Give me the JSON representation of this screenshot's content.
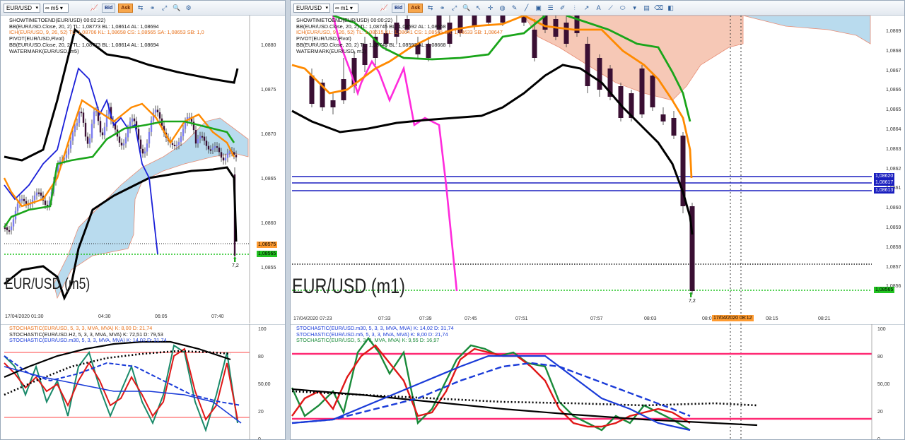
{
  "left_window": {
    "symbol": "EUR/USD",
    "timeframe": "m5",
    "bid_label": "Bid",
    "ask_label": "Ask",
    "legend": [
      {
        "text": "SHOWTIMETOEND(EUR/USD) 00:02:22)",
        "color": "#111111"
      },
      {
        "text": "BB(EUR/USD.Close, 20, 2)  TL: 1,08773  BL: 1,08614  AL: 1,08694",
        "color": "#111111"
      },
      {
        "text": "ICH(EUR/USD, 9, 26, 52)  TL: 1,08706  KL: 1,08658  CS: 1,08565  SA: 1,08653  SB: 1,0",
        "color": "#e8721c"
      },
      {
        "text": "PIVOT(EUR/USD,Pivot)",
        "color": "#111111"
      },
      {
        "text": "BB(EUR/USD.Close, 20, 2)  TL: 1,08773  BL: 1,08614  AL: 1,08694",
        "color": "#111111"
      },
      {
        "text": "WATERMARK(EUR/USD, m5)",
        "color": "#111111"
      }
    ],
    "price_scale": [
      "1,0880",
      "1,0875",
      "1,0870",
      "1,0865",
      "1,0860",
      "1,0855"
    ],
    "price_tag_orange": "1,08575",
    "price_tag_green": "1,08565",
    "arrow_value": "7,2",
    "time_axis": [
      "17/04/2020 01:30",
      "04:30",
      "06:05",
      "07:40"
    ],
    "watermark": "EUR/USD (m5)",
    "osc_legend": [
      {
        "text": "STOCHASTIC(EUR/USD, 5, 3, 3, MVA, MVA)  K: 8,00  D: 21,74",
        "color": "#e8721c"
      },
      {
        "text": "STOCHASTIC(EUR/USD.H2, 5, 3, 3, MVA, MVA)  K: 72,51  D: 79,53",
        "color": "#111111"
      },
      {
        "text": "STOCHASTIC(EUR/USD.m30, 5, 3, 3, MVA, MVA)  K: 14,02  D: 31,74",
        "color": "#1a3bd8"
      }
    ],
    "osc_scale": [
      "100",
      "80",
      "50,00",
      "20",
      "0"
    ]
  },
  "right_window": {
    "symbol": "EUR/USD",
    "timeframe": "m1",
    "bid_label": "Bid",
    "ask_label": "Ask",
    "legend": [
      {
        "text": "SHOWTIMETOEND(EUR/USD) 00:00:22)",
        "color": "#111111"
      },
      {
        "text": "BB(EUR/USD.Close, 20, 2)  TL: 1,08745  BL: 1,08592  AL: 1,08668",
        "color": "#111111"
      },
      {
        "text": "ICH(EUR/USD, 9, 26, 52)  TL: 1,08615  KL: 1,08641  CS: 1,08565  SA: 1,08633  SB: 1,08647",
        "color": "#e8721c"
      },
      {
        "text": "PIVOT(EUR/USD,Pivot)",
        "color": "#111111"
      },
      {
        "text": "BB(EUR/USD.Close, 20, 2)  TL: 1,08745  BL: 1,08592  AL: 1,08668",
        "color": "#111111"
      },
      {
        "text": "WATERMARK(EUR/USD, m1)",
        "color": "#111111"
      }
    ],
    "price_scale": [
      "1,0869",
      "1,0868",
      "1,0867",
      "1,0866",
      "1,0865",
      "1,0864",
      "1,0863",
      "1,0862",
      "1,0861",
      "1,0860",
      "1,0859",
      "1,0858",
      "1,0857",
      "1,0856"
    ],
    "pivot_tags": [
      "1,08620",
      "1,08617",
      "1,08613"
    ],
    "price_tag_green": "1,08565",
    "arrow_value": "7,2",
    "time_axis": [
      "17/04/2020 07:23",
      "07:33",
      "07:39",
      "07:45",
      "07:51",
      "07:57",
      "08:03",
      "08:09",
      "08:15",
      "08:21"
    ],
    "cursor_time": "17/04/2020 08:12",
    "watermark": "EUR/USD (m1)",
    "osc_legend": [
      {
        "text": "STOCHASTIC(EUR/USD.m30, 5, 3, 3, MVA, MVA)  K: 14,02  D: 31,74",
        "color": "#1a3bd8"
      },
      {
        "text": "STOCHASTIC(EUR/USD.m5, 5, 3, 3, MVA, MVA)  K: 8,00  D: 21,74",
        "color": "#1a3bd8"
      },
      {
        "text": "STOCHASTIC(EUR/USD, 5, 3, 3, MVA, MVA)  K: 9,55  D: 16,97",
        "color": "#1a8a3a"
      }
    ],
    "osc_scale": [
      "100",
      "80",
      "50,00",
      "20",
      "0"
    ]
  },
  "colors": {
    "bull_candle": "#7b7cf0",
    "bear_candle": "#3a0f33",
    "cloud_fill": "#b9dbee",
    "cloud_fill_red": "#f6c8b6",
    "pivot_line": "#1a1fbf",
    "green_line": "#21c321",
    "magenta_line": "#ff2bdc",
    "orange_line": "#ff8a00",
    "toolbar_ask": "#f7a64c",
    "osc_band": "#ff2a5c"
  }
}
